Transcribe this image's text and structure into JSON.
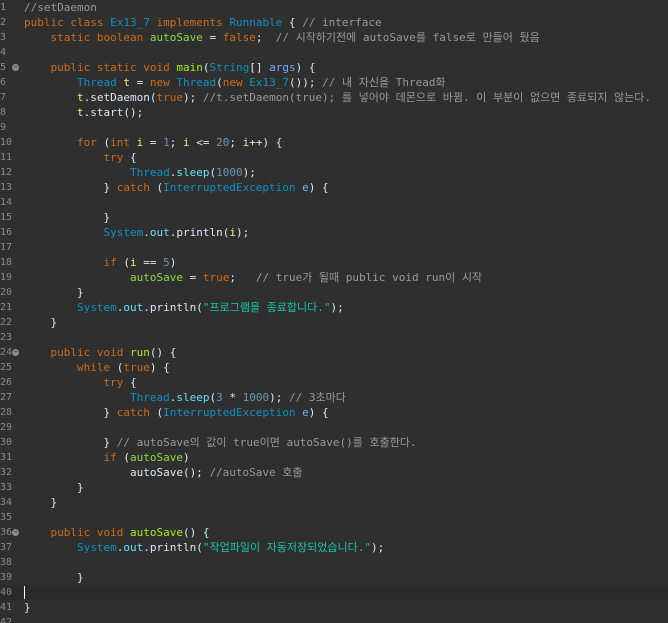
{
  "editor": {
    "name": "code-editor",
    "current_line": 40,
    "caret_line": 40,
    "fold_lines": [
      5,
      24,
      36
    ],
    "lines": [
      {
        "n": "1",
        "tokens": [
          {
            "t": "//setDaemon",
            "c": "c"
          }
        ]
      },
      {
        "n": "2",
        "tokens": [
          {
            "t": "public class ",
            "c": "k"
          },
          {
            "t": "Ex13_7",
            "c": "t"
          },
          {
            "t": " implements ",
            "c": "k"
          },
          {
            "t": "Runnable",
            "c": "t"
          },
          {
            "t": " { ",
            "c": "p"
          },
          {
            "t": "// interface",
            "c": "c"
          }
        ]
      },
      {
        "n": "3",
        "tokens": [
          {
            "t": "    static boolean ",
            "c": "k"
          },
          {
            "t": "autoSave",
            "c": "fi"
          },
          {
            "t": " = ",
            "c": "p"
          },
          {
            "t": "false",
            "c": "k"
          },
          {
            "t": ";  ",
            "c": "p"
          },
          {
            "t": "// 시작하기전에 autoSave를 false로 만들어 뒀음",
            "c": "c"
          }
        ]
      },
      {
        "n": "4",
        "tokens": []
      },
      {
        "n": "5",
        "tokens": [
          {
            "t": "    public static void ",
            "c": "k"
          },
          {
            "t": "main",
            "c": "m"
          },
          {
            "t": "(",
            "c": "p"
          },
          {
            "t": "String",
            "c": "t"
          },
          {
            "t": "[] ",
            "c": "p"
          },
          {
            "t": "args",
            "c": "v"
          },
          {
            "t": ") {",
            "c": "p"
          }
        ]
      },
      {
        "n": "6",
        "tokens": [
          {
            "t": "        ",
            "c": "p"
          },
          {
            "t": "Thread",
            "c": "t"
          },
          {
            "t": " t",
            "c": "l"
          },
          {
            "t": " = ",
            "c": "p"
          },
          {
            "t": "new ",
            "c": "k"
          },
          {
            "t": "Thread",
            "c": "t"
          },
          {
            "t": "(",
            "c": "p"
          },
          {
            "t": "new ",
            "c": "k"
          },
          {
            "t": "Ex13_7",
            "c": "t"
          },
          {
            "t": "()); ",
            "c": "p"
          },
          {
            "t": "// 내 자신을 Thread화",
            "c": "c"
          }
        ]
      },
      {
        "n": "7",
        "tokens": [
          {
            "t": "        t",
            "c": "l"
          },
          {
            "t": ".setDaemon(",
            "c": "p"
          },
          {
            "t": "true",
            "c": "k"
          },
          {
            "t": "); ",
            "c": "p"
          },
          {
            "t": "//t.setDaemon(true); 를 넣어야 데몬으로 바뀜. 이 부분이 없으면 종료되지 않는다.",
            "c": "c"
          }
        ]
      },
      {
        "n": "8",
        "tokens": [
          {
            "t": "        t",
            "c": "l"
          },
          {
            "t": ".start();",
            "c": "p"
          }
        ]
      },
      {
        "n": "9",
        "tokens": []
      },
      {
        "n": "10",
        "tokens": [
          {
            "t": "        ",
            "c": "p"
          },
          {
            "t": "for",
            "c": "k"
          },
          {
            "t": " (",
            "c": "p"
          },
          {
            "t": "int",
            "c": "k"
          },
          {
            "t": " i",
            "c": "l"
          },
          {
            "t": " = ",
            "c": "p"
          },
          {
            "t": "1",
            "c": "n"
          },
          {
            "t": "; ",
            "c": "p"
          },
          {
            "t": "i",
            "c": "l"
          },
          {
            "t": " <= ",
            "c": "p"
          },
          {
            "t": "20",
            "c": "n"
          },
          {
            "t": "; ",
            "c": "p"
          },
          {
            "t": "i",
            "c": "l"
          },
          {
            "t": "++) {",
            "c": "p"
          }
        ]
      },
      {
        "n": "11",
        "tokens": [
          {
            "t": "            ",
            "c": "p"
          },
          {
            "t": "try",
            "c": "k"
          },
          {
            "t": " {",
            "c": "p"
          }
        ]
      },
      {
        "n": "12",
        "tokens": [
          {
            "t": "                ",
            "c": "p"
          },
          {
            "t": "Thread",
            "c": "t"
          },
          {
            "t": ".",
            "c": "p"
          },
          {
            "t": "sleep",
            "c": "f"
          },
          {
            "t": "(",
            "c": "p"
          },
          {
            "t": "1000",
            "c": "n"
          },
          {
            "t": ");",
            "c": "p"
          }
        ]
      },
      {
        "n": "13",
        "tokens": [
          {
            "t": "            } ",
            "c": "p"
          },
          {
            "t": "catch",
            "c": "k"
          },
          {
            "t": " (",
            "c": "p"
          },
          {
            "t": "InterruptedException",
            "c": "t"
          },
          {
            "t": " e",
            "c": "v"
          },
          {
            "t": ") {",
            "c": "p"
          }
        ]
      },
      {
        "n": "14",
        "tokens": []
      },
      {
        "n": "15",
        "tokens": [
          {
            "t": "            }",
            "c": "p"
          }
        ]
      },
      {
        "n": "16",
        "tokens": [
          {
            "t": "            ",
            "c": "p"
          },
          {
            "t": "System",
            "c": "t"
          },
          {
            "t": ".",
            "c": "p"
          },
          {
            "t": "out",
            "c": "f"
          },
          {
            "t": ".println(",
            "c": "p"
          },
          {
            "t": "i",
            "c": "l"
          },
          {
            "t": ");",
            "c": "p"
          }
        ]
      },
      {
        "n": "17",
        "tokens": []
      },
      {
        "n": "18",
        "tokens": [
          {
            "t": "            ",
            "c": "p"
          },
          {
            "t": "if",
            "c": "k"
          },
          {
            "t": " (",
            "c": "p"
          },
          {
            "t": "i",
            "c": "l"
          },
          {
            "t": " == ",
            "c": "p"
          },
          {
            "t": "5",
            "c": "n"
          },
          {
            "t": ")",
            "c": "p"
          }
        ]
      },
      {
        "n": "19",
        "tokens": [
          {
            "t": "                ",
            "c": "p"
          },
          {
            "t": "autoSave",
            "c": "fi"
          },
          {
            "t": " = ",
            "c": "p"
          },
          {
            "t": "true",
            "c": "k"
          },
          {
            "t": ";   ",
            "c": "p"
          },
          {
            "t": "// true가 될때 public void run이 시작",
            "c": "c"
          }
        ]
      },
      {
        "n": "20",
        "tokens": [
          {
            "t": "        }",
            "c": "p"
          }
        ]
      },
      {
        "n": "21",
        "tokens": [
          {
            "t": "        ",
            "c": "p"
          },
          {
            "t": "System",
            "c": "t"
          },
          {
            "t": ".",
            "c": "p"
          },
          {
            "t": "out",
            "c": "f"
          },
          {
            "t": ".println(",
            "c": "p"
          },
          {
            "t": "\"프로그램을 종료합니다.\"",
            "c": "s"
          },
          {
            "t": ");",
            "c": "p"
          }
        ]
      },
      {
        "n": "22",
        "tokens": [
          {
            "t": "    }",
            "c": "p"
          }
        ]
      },
      {
        "n": "23",
        "tokens": []
      },
      {
        "n": "24",
        "tokens": [
          {
            "t": "    public void ",
            "c": "k"
          },
          {
            "t": "run",
            "c": "m"
          },
          {
            "t": "() {",
            "c": "p"
          }
        ]
      },
      {
        "n": "25",
        "tokens": [
          {
            "t": "        ",
            "c": "p"
          },
          {
            "t": "while",
            "c": "k"
          },
          {
            "t": " (",
            "c": "p"
          },
          {
            "t": "true",
            "c": "k"
          },
          {
            "t": ") {",
            "c": "p"
          }
        ]
      },
      {
        "n": "26",
        "tokens": [
          {
            "t": "            ",
            "c": "p"
          },
          {
            "t": "try",
            "c": "k"
          },
          {
            "t": " {",
            "c": "p"
          }
        ]
      },
      {
        "n": "27",
        "tokens": [
          {
            "t": "                ",
            "c": "p"
          },
          {
            "t": "Thread",
            "c": "t"
          },
          {
            "t": ".",
            "c": "p"
          },
          {
            "t": "sleep",
            "c": "f"
          },
          {
            "t": "(",
            "c": "p"
          },
          {
            "t": "3",
            "c": "n"
          },
          {
            "t": " * ",
            "c": "p"
          },
          {
            "t": "1000",
            "c": "n"
          },
          {
            "t": "); ",
            "c": "p"
          },
          {
            "t": "// 3초마다",
            "c": "c"
          }
        ]
      },
      {
        "n": "28",
        "tokens": [
          {
            "t": "            } ",
            "c": "p"
          },
          {
            "t": "catch",
            "c": "k"
          },
          {
            "t": " (",
            "c": "p"
          },
          {
            "t": "InterruptedException",
            "c": "t"
          },
          {
            "t": " e",
            "c": "v"
          },
          {
            "t": ") {",
            "c": "p"
          }
        ]
      },
      {
        "n": "29",
        "tokens": []
      },
      {
        "n": "30",
        "tokens": [
          {
            "t": "            } ",
            "c": "p"
          },
          {
            "t": "// autoSave의 값이 true이면 autoSave()를 호출한다.",
            "c": "c"
          }
        ]
      },
      {
        "n": "31",
        "tokens": [
          {
            "t": "            ",
            "c": "p"
          },
          {
            "t": "if",
            "c": "k"
          },
          {
            "t": " (",
            "c": "p"
          },
          {
            "t": "autoSave",
            "c": "fi"
          },
          {
            "t": ")",
            "c": "p"
          }
        ]
      },
      {
        "n": "32",
        "tokens": [
          {
            "t": "                autoSave(); ",
            "c": "p"
          },
          {
            "t": "//autoSave 호출",
            "c": "c"
          }
        ]
      },
      {
        "n": "33",
        "tokens": [
          {
            "t": "        }",
            "c": "p"
          }
        ]
      },
      {
        "n": "34",
        "tokens": [
          {
            "t": "    }",
            "c": "p"
          }
        ]
      },
      {
        "n": "35",
        "tokens": []
      },
      {
        "n": "36",
        "tokens": [
          {
            "t": "    public void ",
            "c": "k"
          },
          {
            "t": "autoSave",
            "c": "m"
          },
          {
            "t": "() {",
            "c": "p"
          }
        ]
      },
      {
        "n": "37",
        "tokens": [
          {
            "t": "        ",
            "c": "p"
          },
          {
            "t": "System",
            "c": "t"
          },
          {
            "t": ".",
            "c": "p"
          },
          {
            "t": "out",
            "c": "f"
          },
          {
            "t": ".println(",
            "c": "p"
          },
          {
            "t": "\"작업파일이 자동저장되었습니다.\"",
            "c": "s"
          },
          {
            "t": ");",
            "c": "p"
          }
        ]
      },
      {
        "n": "38",
        "tokens": []
      },
      {
        "n": "39",
        "tokens": [
          {
            "t": "        }",
            "c": "p"
          }
        ]
      },
      {
        "n": "40",
        "tokens": []
      },
      {
        "n": "41",
        "tokens": [
          {
            "t": "}",
            "c": "p"
          }
        ]
      },
      {
        "n": "42",
        "tokens": []
      }
    ]
  },
  "colors": {
    "background": "#2f2f2f",
    "current_line": "#2a2a2a",
    "keyword": "#cc6c1d",
    "comment": "#999999",
    "type": "#1290c3",
    "method_decl": "#a7ec21",
    "static_field": "#66e1f8",
    "string": "#17c6a3",
    "number": "#6897bb",
    "local_var": "#f3ec79",
    "plain": "#d9e8f7"
  }
}
